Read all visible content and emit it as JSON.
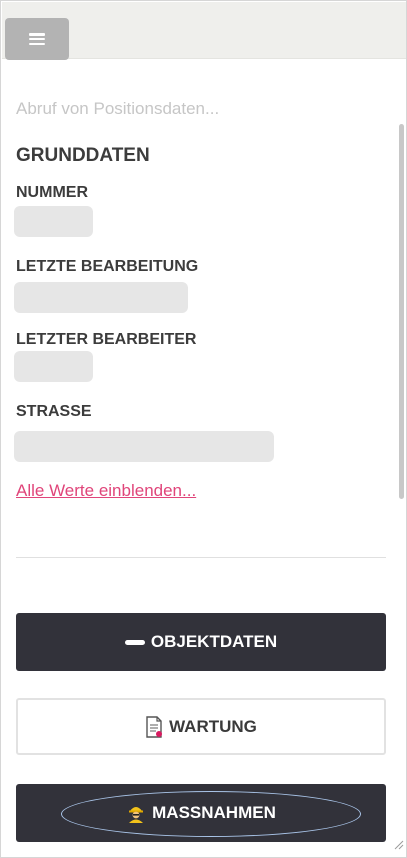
{
  "status": {
    "loading_text": "Abruf von Positionsdaten..."
  },
  "section": {
    "title": "GRUNDDATEN"
  },
  "fields": [
    {
      "label": "NUMMER",
      "value": ""
    },
    {
      "label": "LETZTE BEARBEITUNG",
      "value": ""
    },
    {
      "label": "LETZTER BEARBEITER",
      "value": ""
    },
    {
      "label": "STRASSE",
      "value": ""
    }
  ],
  "links": {
    "show_all": "Alle Werte einblenden..."
  },
  "actions": {
    "objektdaten": "OBJEKTDATEN",
    "wartung": "WARTUNG",
    "massnahmen": "MASSNAHMEN"
  },
  "colors": {
    "link": "#e0457a",
    "dark_button": "#32323a",
    "topbar": "#efefec",
    "placeholder": "#e6e6e6"
  },
  "icons": {
    "menu": "hamburger-icon",
    "objektdaten": "minus-icon",
    "wartung": "document-icon",
    "massnahmen": "worker-icon"
  }
}
